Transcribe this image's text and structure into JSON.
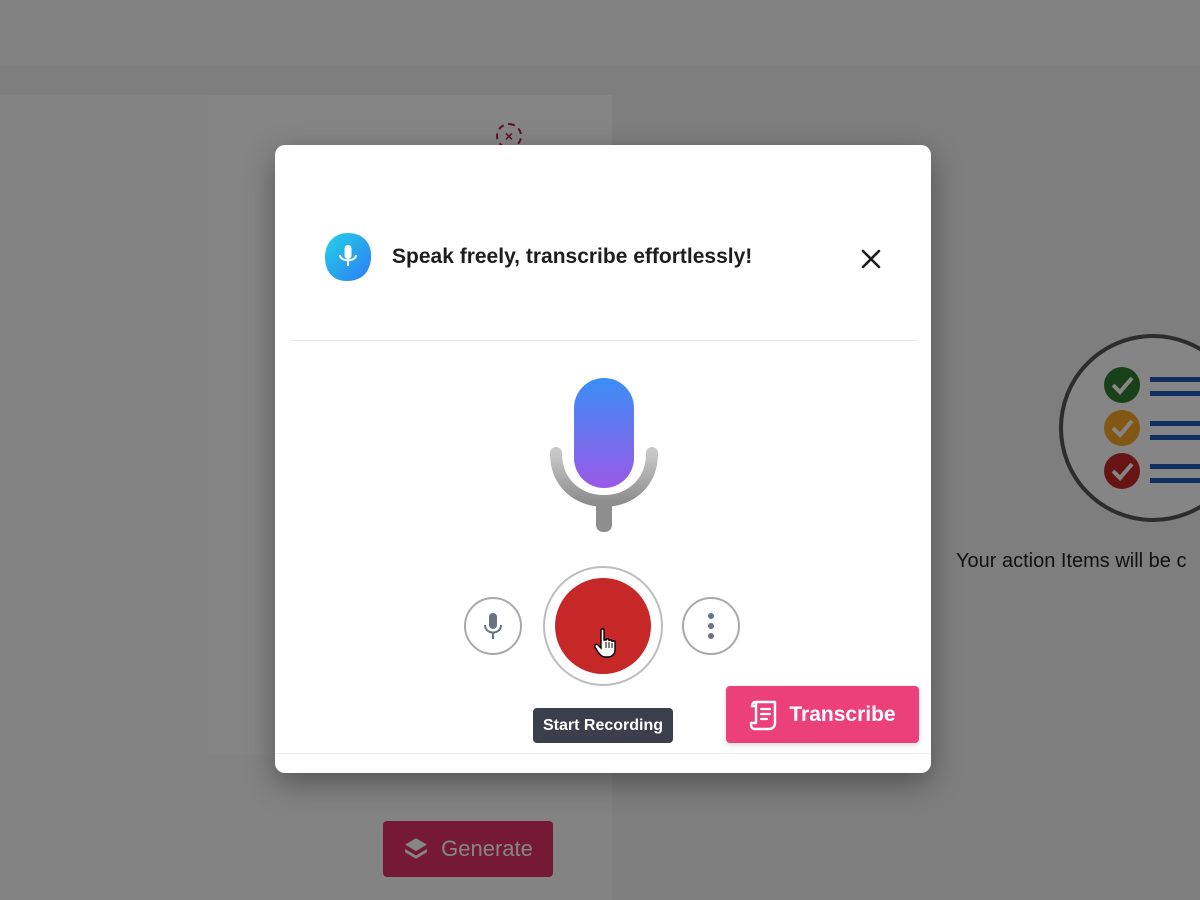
{
  "background": {
    "generate_label": "Generate",
    "action_items_text": "Your action Items will be c",
    "close_icon_glyph": "×"
  },
  "modal": {
    "title": "Speak freely, transcribe effortlessly!",
    "tooltip": "Start Recording",
    "transcribe_label": "Transcribe"
  },
  "icons": {
    "logo": "microphone-logo-icon",
    "close": "close-icon",
    "big_mic": "microphone-icon",
    "small_mic": "microphone-icon",
    "record": "record-icon",
    "more": "more-vertical-icon",
    "transcribe": "document-icon",
    "generate": "layers-icon",
    "cursor": "hand-cursor-icon"
  },
  "colors": {
    "overlay": "#000000",
    "record_red": "#c62828",
    "transcribe_pink": "#ec407a",
    "generate_pink": "#e0306a",
    "tooltip_bg": "#3a3f4b",
    "mic_gradient_top": "#3a8ef6",
    "mic_gradient_bottom": "#9b59e6",
    "logo_cyan": "#23d3e6",
    "logo_blue": "#2e9bf5"
  }
}
